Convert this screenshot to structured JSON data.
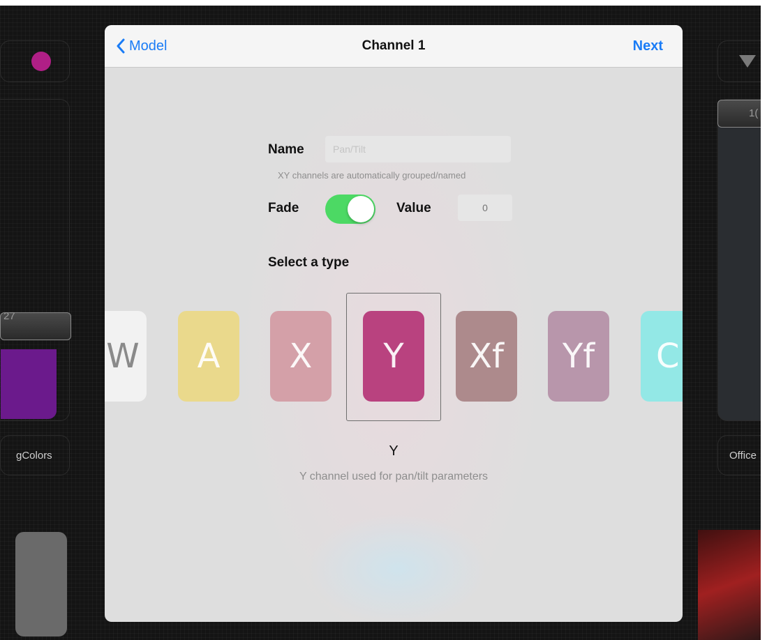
{
  "background": {
    "left_fader_value": "27",
    "left_scene_label": "gColors",
    "right_fader_value": "1(",
    "right_scene_label": "Office"
  },
  "navbar": {
    "back_label": "Model",
    "title": "Channel 1",
    "next_label": "Next"
  },
  "form": {
    "name_label": "Name",
    "name_value": "",
    "name_placeholder": "Pan/Tilt",
    "name_hint": "XY channels are automatically grouped/named",
    "fade_label": "Fade",
    "fade_on": true,
    "value_label": "Value",
    "value_placeholder": "0",
    "type_heading": "Select a type"
  },
  "types": [
    {
      "label": "W",
      "color": "#f2f2f2"
    },
    {
      "label": "A",
      "color": "#ead98c"
    },
    {
      "label": "X",
      "color": "#d4a0a8"
    },
    {
      "label": "Y",
      "color": "#b9427f"
    },
    {
      "label": "Xf",
      "color": "#ad8a8c"
    },
    {
      "label": "Yf",
      "color": "#b896ab"
    },
    {
      "label": "C",
      "color": "#93e8e6"
    }
  ],
  "selected_type": {
    "label": "Y",
    "description": "Y channel used for pan/tilt parameters"
  },
  "colors": {
    "accent": "#1a7cf6",
    "toggle_on": "#4cd964"
  }
}
